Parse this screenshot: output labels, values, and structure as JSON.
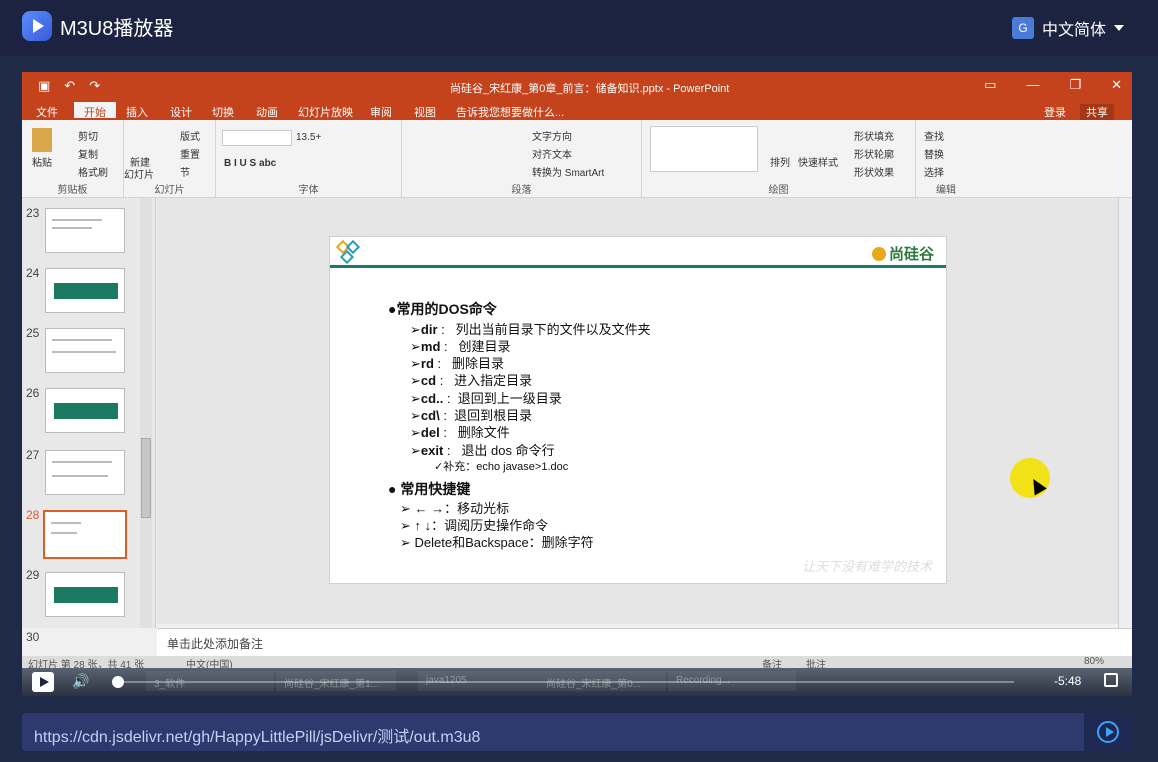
{
  "app": {
    "title": "M3U8播放器",
    "language": "中文简体"
  },
  "ppt": {
    "doc_title": "尚硅谷_宋红康_第0章_前言：储备知识.pptx - PowerPoint",
    "tabs": [
      "文件",
      "开始",
      "插入",
      "设计",
      "切换",
      "动画",
      "幻灯片放映",
      "审阅",
      "视图",
      "告诉我您想要做什么..."
    ],
    "login": "登录",
    "share": "共享",
    "ribbon": {
      "clipboard": {
        "label": "剪贴板",
        "paste": "粘贴",
        "cut": "剪切",
        "copy": "复制",
        "format": "格式刷"
      },
      "slides": {
        "label": "幻灯片",
        "new": "新建",
        "new2": "幻灯片",
        "layout": "版式",
        "reset": "重置",
        "section": "节"
      },
      "font": {
        "label": "字体",
        "size": "13.5+"
      },
      "paragraph": {
        "label": "段落",
        "dir": "文字方向",
        "align": "对齐文本",
        "smartart": "转换为 SmartArt"
      },
      "drawing": {
        "label": "绘图",
        "arrange": "排列",
        "quick": "快速样式",
        "fill": "形状填充",
        "outline": "形状轮廓",
        "effect": "形状效果"
      },
      "editing": {
        "label": "编辑",
        "find": "查找",
        "replace": "替换",
        "select": "选择"
      }
    },
    "thumb_numbers": [
      "23",
      "24",
      "25",
      "26",
      "27",
      "28",
      "29",
      "30"
    ],
    "slide": {
      "logo": "尚硅谷",
      "heading1": "●常用的DOS命令",
      "commands": [
        {
          "cmd": "dir",
          "desc": "列出当前目录下的文件以及文件夹"
        },
        {
          "cmd": "md",
          "desc": "创建目录"
        },
        {
          "cmd": "rd",
          "desc": "删除目录"
        },
        {
          "cmd": "cd",
          "desc": "进入指定目录"
        },
        {
          "cmd": "cd..",
          "desc": "退回到上一级目录"
        },
        {
          "cmd": "cd\\",
          "desc": "退回到根目录"
        },
        {
          "cmd": "del",
          "desc": "删除文件"
        },
        {
          "cmd": "exit",
          "desc": "退出 dos 命令行"
        }
      ],
      "supplement": "✓补充：echo javase>1.doc",
      "heading2": "●  常用快捷键",
      "shortcuts": [
        "➢  ←  →：移动光标",
        "➢  ↑  ↓：调阅历史操作命令",
        "➢  Delete和Backspace：删除字符"
      ],
      "slogan": "让天下没有难学的技术"
    },
    "notes": "单击此处添加备注",
    "status": {
      "slide_info": "幻灯片 第 28 张，共 41 张",
      "language": "中文(中国)",
      "notes_btn": "备注",
      "comments_btn": "批注",
      "zoom": "80%"
    }
  },
  "player": {
    "time": "-5:48"
  },
  "taskbar_ghost": [
    "3_软件",
    "尚硅谷_宋红康_第1...",
    "java1205",
    "尚硅谷_宋红康_第0...",
    "Recording..."
  ],
  "url": "https://cdn.jsdelivr.net/gh/HappyLittlePill/jsDelivr/测试/out.m3u8"
}
